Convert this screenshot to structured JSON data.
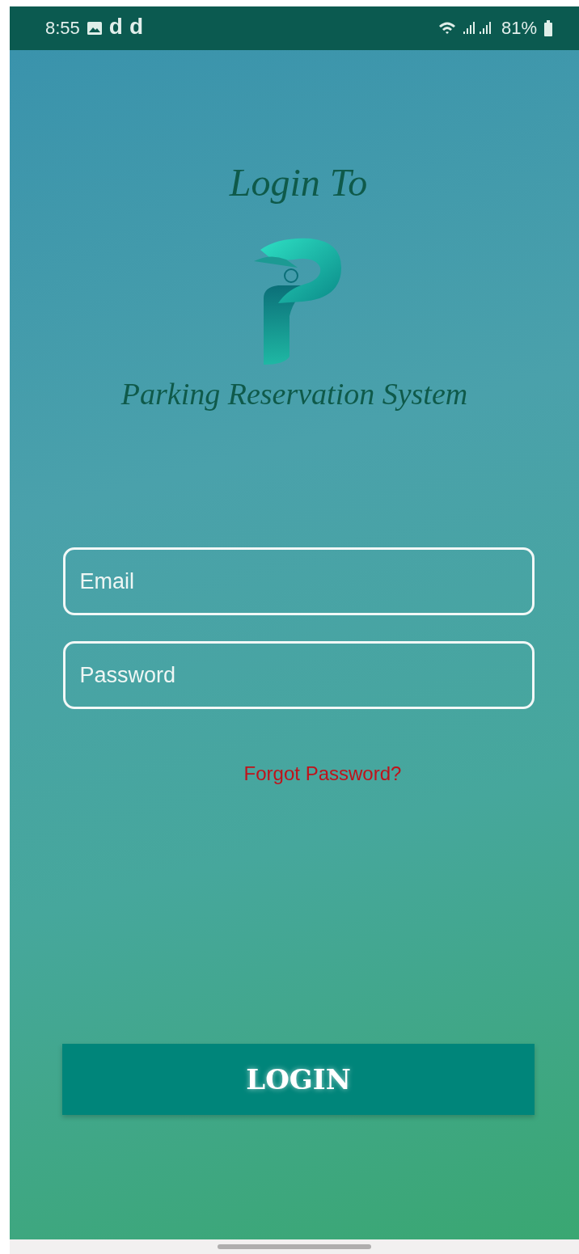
{
  "status_bar": {
    "time": "8:55",
    "notification_letters": [
      "d",
      "d"
    ],
    "battery": "81%"
  },
  "header": {
    "title": "Login To",
    "subtitle": "Parking Reservation System"
  },
  "form": {
    "fields": [
      {
        "placeholder": "Email"
      },
      {
        "placeholder": "Password"
      }
    ],
    "forgot_link": "Forgot Password?",
    "submit": "LOGIN"
  }
}
